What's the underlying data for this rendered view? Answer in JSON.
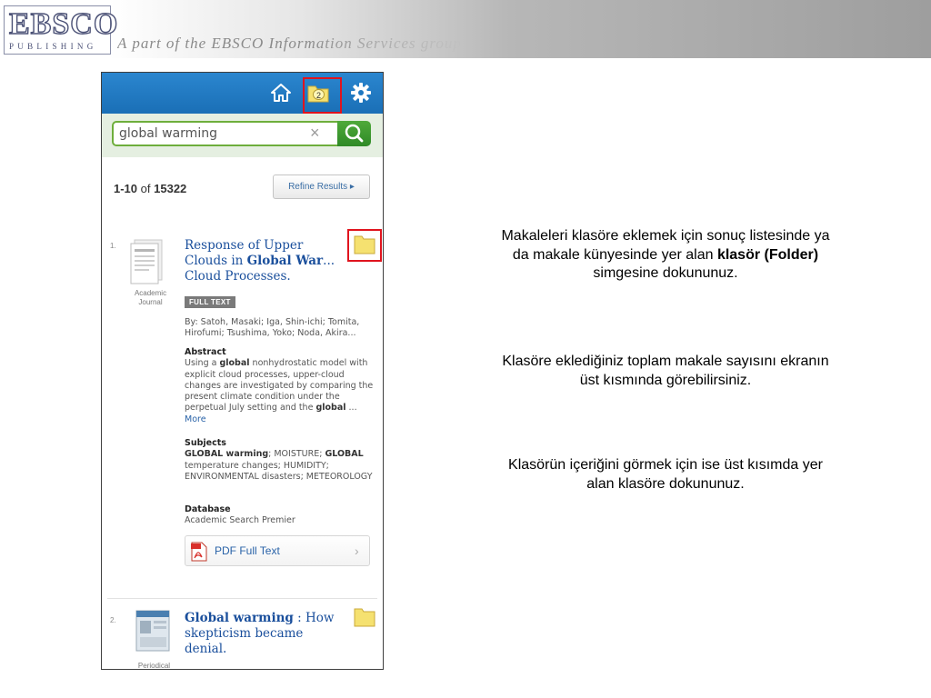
{
  "header": {
    "logo_main": "EBSCO",
    "logo_sub": "PUBLISHING",
    "tagline": "A part of the EBSCO Information Services group"
  },
  "app": {
    "top_bar": {
      "icons": [
        "home-icon",
        "folder-icon",
        "settings-icon"
      ],
      "folder_count": "2",
      "color": "#1f78c1"
    },
    "search": {
      "query": "global warming",
      "clear_icon": "×"
    },
    "results": {
      "range": "1-10",
      "of": "of",
      "total": "15322",
      "refine_label": "Refine Results ▸",
      "items": [
        {
          "rank": "1.",
          "type": "Academic Journal",
          "type_line1": "Academic",
          "type_line2": "Journal",
          "title_pre": "Response of Upper Clouds in ",
          "title_bold": "Global War",
          "title_post": "... Cloud Processes.",
          "badge": "FULL TEXT",
          "authors": "By: Satoh, Masaki; Iga, Shin-ichi; Tomita, Hirofumi; Tsushima, Yoko; Noda, Akira...",
          "abstract_heading": "Abstract",
          "abstract": "Using a global nonhydrostatic model with explicit cloud processes, upper-cloud changes are investigated by comparing the present climate condition under the perpetual July setting and the global ... More",
          "more_label": "More",
          "subjects_heading": "Subjects",
          "subjects": "GLOBAL warming; MOISTURE; GLOBAL temperature changes; HUMIDITY; ENVIRONMENTAL disasters; METEOROLOGY",
          "database_heading": "Database",
          "database": "Academic Search Premier",
          "pdf_label": "PDF Full Text"
        },
        {
          "rank": "2.",
          "type": "Periodical",
          "title_bold": "Global warming",
          "title_post": " : How skepticism became denial."
        }
      ]
    }
  },
  "instructions": {
    "p1_pre": "Makaleleri klasöre eklemek için sonuç listesinde ya da makale künyesinde yer alan ",
    "p1_bold": "klasör (Folder)",
    "p1_post": " simgesine dokununuz.",
    "p2": "Klasöre eklediğiniz toplam makale sayısını ekranın üst kısmında görebilirsiniz.",
    "p3": "Klasörün içeriğini görmek için ise üst kısımda yer alan klasöre dokununuz."
  },
  "colors": {
    "highlight": "#e0141e",
    "search_green": "#3c9a2e",
    "title_blue": "#1a4f9c",
    "folder_yellow": "#f5e170"
  }
}
